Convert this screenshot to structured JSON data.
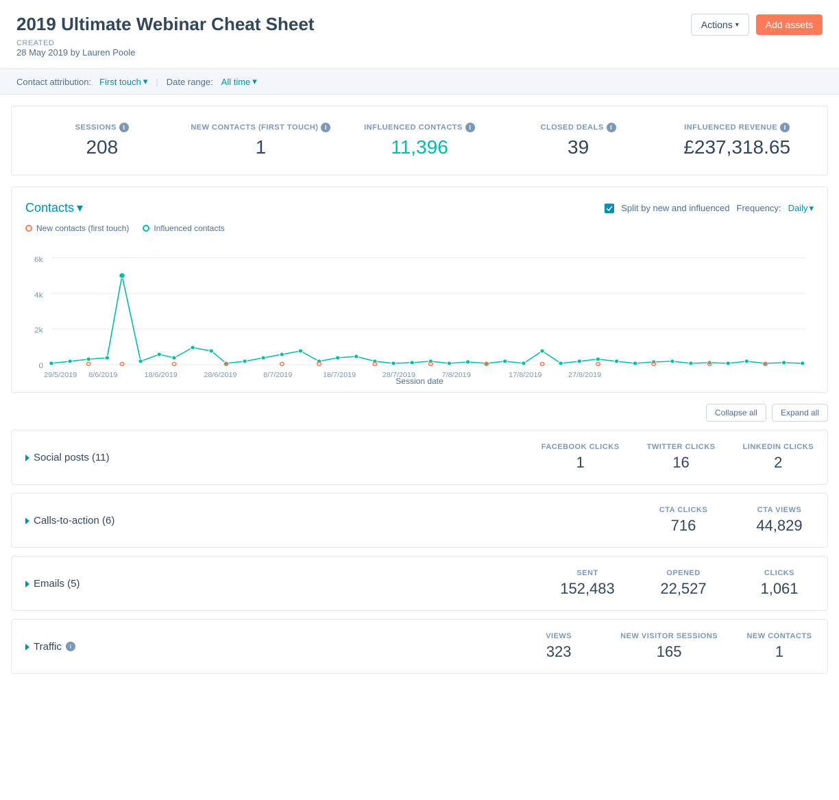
{
  "page": {
    "title": "2019 Ultimate Webinar Cheat Sheet",
    "created_label": "Created",
    "created_by": "28 May 2019 by Lauren Poole"
  },
  "header": {
    "actions_label": "Actions",
    "add_assets_label": "Add assets"
  },
  "filters": {
    "contact_attribution_label": "Contact attribution:",
    "contact_attribution_value": "First touch",
    "date_range_label": "Date range:",
    "date_range_value": "All time"
  },
  "stats": [
    {
      "label": "SESSIONS",
      "value": "208",
      "teal": false,
      "info": true
    },
    {
      "label": "NEW CONTACTS (FIRST TOUCH)",
      "value": "1",
      "teal": false,
      "info": true
    },
    {
      "label": "INFLUENCED CONTACTS",
      "value": "11,396",
      "teal": true,
      "info": true
    },
    {
      "label": "CLOSED DEALS",
      "value": "39",
      "teal": false,
      "info": true
    },
    {
      "label": "INFLUENCED REVENUE",
      "value": "£237,318.65",
      "teal": false,
      "info": true
    }
  ],
  "chart": {
    "title": "Contacts",
    "split_label": "Split by new and influenced",
    "frequency_label": "Frequency:",
    "frequency_value": "Daily",
    "legend": [
      {
        "label": "New contacts (first touch)",
        "type": "orange"
      },
      {
        "label": "Influenced contacts",
        "type": "teal"
      }
    ],
    "x_axis_label": "Session date",
    "y_axis": [
      "0",
      "2k",
      "4k",
      "6k"
    ],
    "x_labels": [
      "29/5/2019",
      "8/6/2019",
      "18/6/2019",
      "28/6/2019",
      "8/7/2019",
      "18/7/2019",
      "28/7/2019",
      "7/8/2019",
      "17/8/2019",
      "27/8/2019"
    ]
  },
  "section_controls": {
    "collapse_all": "Collapse all",
    "expand_all": "Expand all"
  },
  "sections": [
    {
      "name": "Social posts (11)",
      "info": false,
      "stats": [
        {
          "label": "FACEBOOK CLICKS",
          "value": "1"
        },
        {
          "label": "TWITTER CLICKS",
          "value": "16"
        },
        {
          "label": "LINKEDIN CLICKS",
          "value": "2"
        }
      ]
    },
    {
      "name": "Calls-to-action (6)",
      "info": false,
      "stats": [
        {
          "label": "CTA CLICKS",
          "value": "716"
        },
        {
          "label": "CTA VIEWS",
          "value": "44,829"
        }
      ]
    },
    {
      "name": "Emails (5)",
      "info": false,
      "stats": [
        {
          "label": "SENT",
          "value": "152,483"
        },
        {
          "label": "OPENED",
          "value": "22,527"
        },
        {
          "label": "CLICKS",
          "value": "1,061"
        }
      ]
    },
    {
      "name": "Traffic",
      "info": true,
      "stats": [
        {
          "label": "VIEWS",
          "value": "323"
        },
        {
          "label": "NEW VISITOR SESSIONS",
          "value": "165"
        },
        {
          "label": "NEW CONTACTS",
          "value": "1"
        }
      ]
    }
  ]
}
